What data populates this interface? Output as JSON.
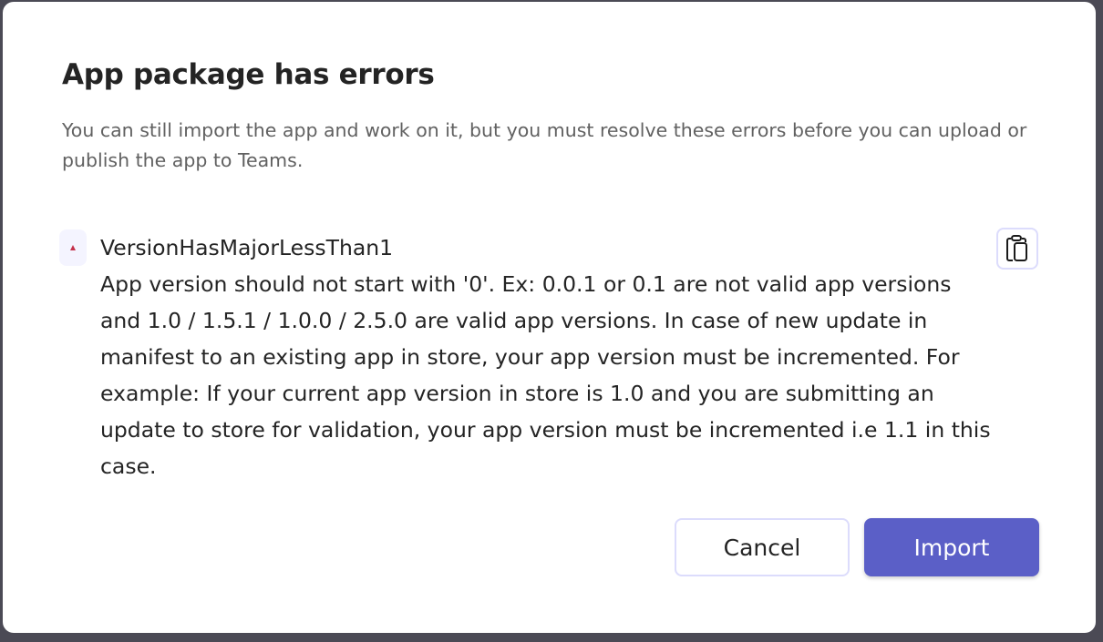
{
  "dialog": {
    "title": "App package has errors",
    "subtitle": "You can still import the app and work on it, but you must resolve these errors before you can upload or publish the app to Teams.",
    "errors": [
      {
        "icon": "warning-triangle-icon",
        "code": "VersionHasMajorLessThan1",
        "message": "App version should not start with '0'. Ex: 0.0.1 or 0.1 are not valid app versions and 1.0 / 1.5.1 / 1.0.0 / 2.5.0 are valid app versions. In case of new update in manifest to an existing app in store, your app version must be incremented. For example: If your current app version in store is 1.0 and you are submitting an update to store for validation, your app version must be incremented i.e 1.1 in this case."
      }
    ],
    "copy_icon": "copy-icon",
    "cancel_label": "Cancel",
    "import_label": "Import",
    "colors": {
      "primary": "#5b5fc7",
      "error": "#c4314b",
      "backdrop": "#4b4a55"
    }
  }
}
